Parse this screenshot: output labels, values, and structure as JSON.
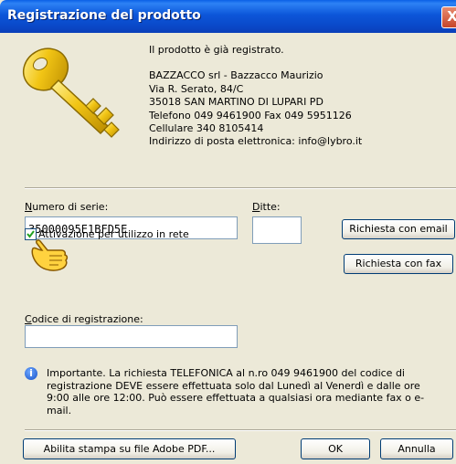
{
  "window": {
    "title": "Registrazione del prodotto",
    "close_label": "X"
  },
  "info": {
    "status": "Il prodotto è già registrato.",
    "company": "BAZZACCO srl - Bazzacco Maurizio",
    "address": "Via R. Serato, 84/C",
    "city": "35018 SAN MARTINO DI LUPARI PD",
    "phone": "Telefono 049 9461900  Fax 049 5951126",
    "mobile": "Cellulare 340 8105414",
    "email": "Indirizzo di posta elettronica: info@lybro.it"
  },
  "form": {
    "serial_label_key": "N",
    "serial_label_rest": "umero di serie:",
    "serial_value": "35000095E1BFD5E",
    "ditte_label_key": "D",
    "ditte_label_rest": "itte:",
    "ditte_value": "",
    "network_activation_label": "Attivazione per utilizzo in rete",
    "network_activation_checked": true,
    "reg_code_label_key": "C",
    "reg_code_label_rest": "odice di registrazione:",
    "reg_code_value": ""
  },
  "buttons": {
    "request_email": "Richiesta con email",
    "request_fax": "Richiesta con fax",
    "enable_pdf": "Abilita stampa su file Adobe PDF...",
    "ok": "OK",
    "cancel": "Annulla"
  },
  "note": {
    "text": "Importante. La richiesta TELEFONICA al n.ro 049 9461900 del codice di registrazione DEVE essere effettuata solo dal Lunedì al Venerdì e dalle ore 9:00 alle ore 12:00. Può essere effettuata a qualsiasi ora mediante fax o e-mail."
  },
  "icons": {
    "key": "key-icon",
    "hand": "pointing-hand-icon",
    "info": "info-icon"
  },
  "colors": {
    "titlebar": "#0a48c8",
    "dialog_bg": "#ece9d8",
    "key_gold": "#f2c515"
  }
}
